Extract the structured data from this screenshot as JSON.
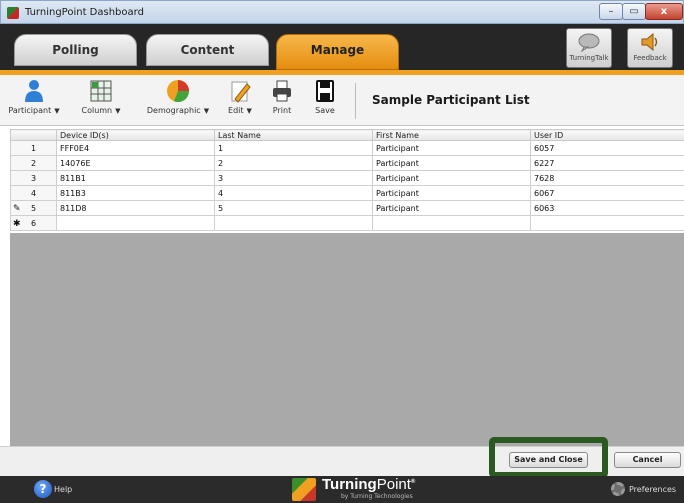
{
  "window": {
    "title": "TurningPoint Dashboard",
    "min": "–",
    "max": "▭",
    "close": "x"
  },
  "tabs": [
    {
      "label": "Polling",
      "active": false
    },
    {
      "label": "Content",
      "active": false
    },
    {
      "label": "Manage",
      "active": true
    }
  ],
  "top_right": {
    "turningtalk": "TurningTalk",
    "feedback": "Feedback"
  },
  "toolbar": {
    "participant": "Participant",
    "column": "Column",
    "demographic": "Demographic",
    "edit": "Edit",
    "print": "Print",
    "save": "Save",
    "caret": "▼",
    "list_title": "Sample Participant List"
  },
  "table": {
    "columns": [
      "Device ID(s)",
      "Last Name",
      "First Name",
      "User ID"
    ],
    "rows": [
      {
        "n": "1",
        "device": "FFF0E4",
        "last": "1",
        "first": "Participant",
        "uid": "6057",
        "mark": ""
      },
      {
        "n": "2",
        "device": "14076E",
        "last": "2",
        "first": "Participant",
        "uid": "6227",
        "mark": ""
      },
      {
        "n": "3",
        "device": "811B1",
        "last": "3",
        "first": "Participant",
        "uid": "7628",
        "mark": ""
      },
      {
        "n": "4",
        "device": "811B3",
        "last": "4",
        "first": "Participant",
        "uid": "6067",
        "mark": ""
      },
      {
        "n": "5",
        "device": "811D8",
        "last": "5",
        "first": "Participant",
        "uid": "6063",
        "mark": "✎"
      },
      {
        "n": "6",
        "device": "",
        "last": "",
        "first": "",
        "uid": "",
        "mark": "✱"
      }
    ]
  },
  "actions": {
    "save_close": "Save and Close",
    "cancel": "Cancel"
  },
  "footer": {
    "help": "Help",
    "logo_bold": "Turning",
    "logo_light": "Point",
    "logo_tm": "®",
    "logo_sub": "by Turning Technologies",
    "preferences": "Preferences"
  },
  "colors": {
    "accent": "#f0a020",
    "highlight": "#2a5a22",
    "dark": "#2b2b2b"
  }
}
